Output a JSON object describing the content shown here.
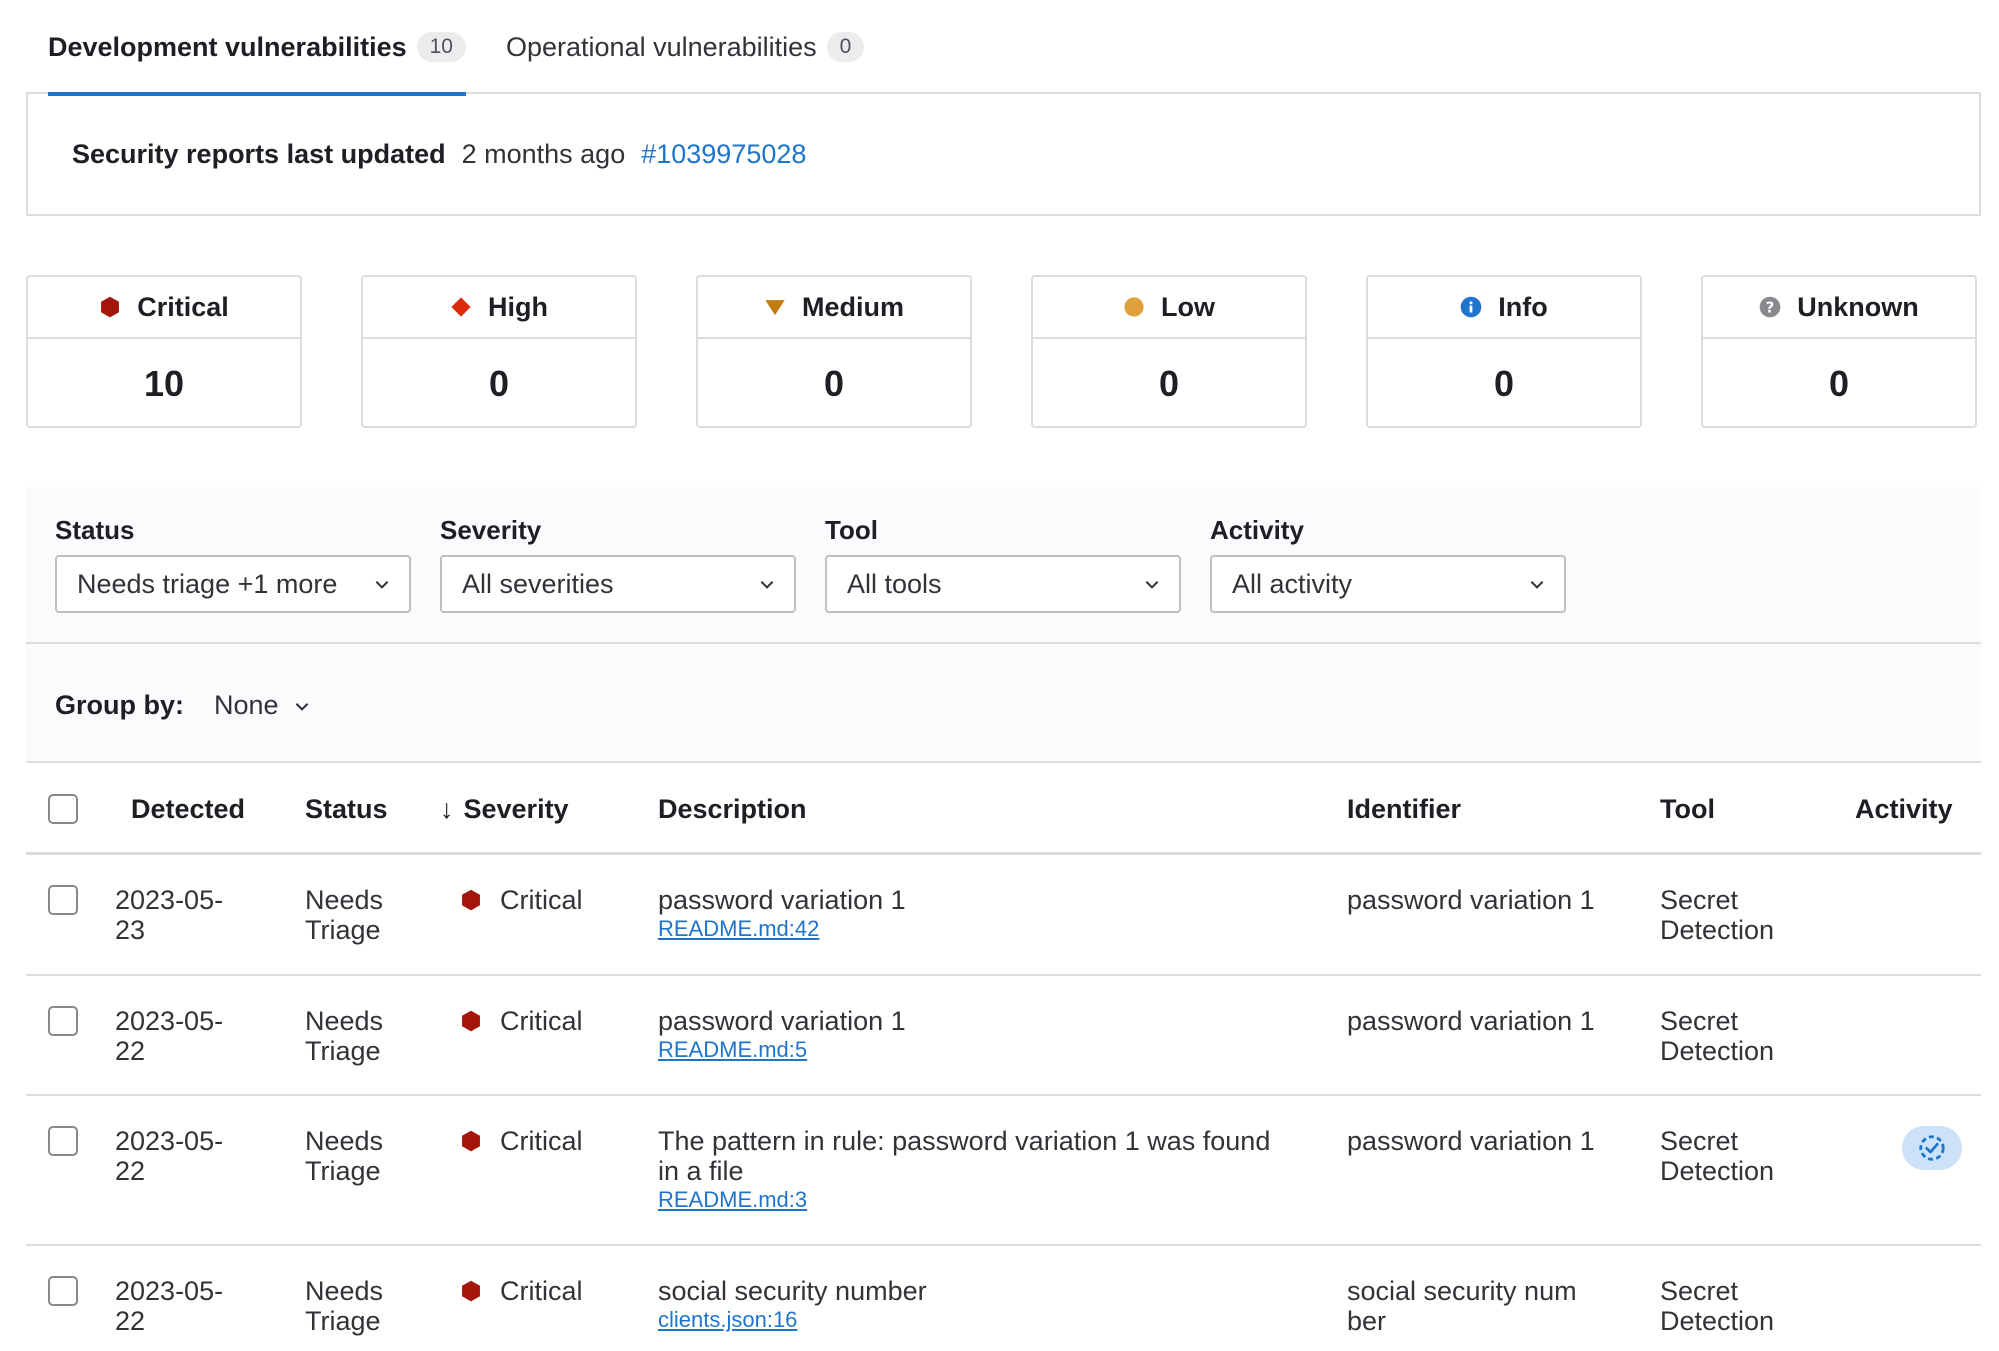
{
  "tabs": [
    {
      "label": "Development vulnerabilities",
      "count": "10",
      "active": true
    },
    {
      "label": "Operational vulnerabilities",
      "count": "0",
      "active": false
    }
  ],
  "updated": {
    "label": "Security reports last updated",
    "time": "2 months ago",
    "pipeline": "#1039975028"
  },
  "severity_cards": [
    {
      "label": "Critical",
      "count": "10",
      "icon": "critical-hexagon-icon",
      "color": "#a4160c"
    },
    {
      "label": "High",
      "count": "0",
      "icon": "high-diamond-icon",
      "color": "#dd2b0e"
    },
    {
      "label": "Medium",
      "count": "0",
      "icon": "medium-triangle-icon",
      "color": "#c17d10"
    },
    {
      "label": "Low",
      "count": "0",
      "icon": "low-circle-icon",
      "color": "#e0a03b"
    },
    {
      "label": "Info",
      "count": "0",
      "icon": "info-circle-icon",
      "color": "#1f75cb"
    },
    {
      "label": "Unknown",
      "count": "0",
      "icon": "unknown-question-icon",
      "color": "#89888d"
    }
  ],
  "filters": [
    {
      "label": "Status",
      "value": "Needs triage +1 more"
    },
    {
      "label": "Severity",
      "value": "All severities"
    },
    {
      "label": "Tool",
      "value": "All tools"
    },
    {
      "label": "Activity",
      "value": "All activity"
    }
  ],
  "group_by": {
    "label": "Group by:",
    "value": "None"
  },
  "table": {
    "headers": {
      "detected": "Detected",
      "status": "Status",
      "sort_arrow": "↓",
      "severity": "Severity",
      "description": "Description",
      "identifier": "Identifier",
      "tool": "Tool",
      "activity": "Activity"
    },
    "rows": [
      {
        "detected": [
          "2023-05-",
          "23"
        ],
        "status": [
          "Needs",
          "Triage"
        ],
        "severity": "Critical",
        "description": [
          "password variation 1"
        ],
        "file": "README.md:42",
        "identifier": [
          "password variation 1"
        ],
        "tool": [
          "Secret",
          "Detection"
        ],
        "activity": false
      },
      {
        "detected": [
          "2023-05-",
          "22"
        ],
        "status": [
          "Needs",
          "Triage"
        ],
        "severity": "Critical",
        "description": [
          "password variation 1"
        ],
        "file": "README.md:5",
        "identifier": [
          "password variation 1"
        ],
        "tool": [
          "Secret",
          "Detection"
        ],
        "activity": false
      },
      {
        "detected": [
          "2023-05-",
          "22"
        ],
        "status": [
          "Needs",
          "Triage"
        ],
        "severity": "Critical",
        "description": [
          "The pattern in rule: password variation 1 was found",
          "in a file"
        ],
        "file": "README.md:3",
        "identifier": [
          "password variation 1"
        ],
        "tool": [
          "Secret",
          "Detection"
        ],
        "activity": true
      },
      {
        "detected": [
          "2023-05-",
          "22"
        ],
        "status": [
          "Needs",
          "Triage"
        ],
        "severity": "Critical",
        "description": [
          "social security number"
        ],
        "file": "clients.json:16",
        "identifier": [
          "social security num",
          "ber"
        ],
        "tool": [
          "Secret",
          "Detection"
        ],
        "activity": false
      }
    ]
  }
}
